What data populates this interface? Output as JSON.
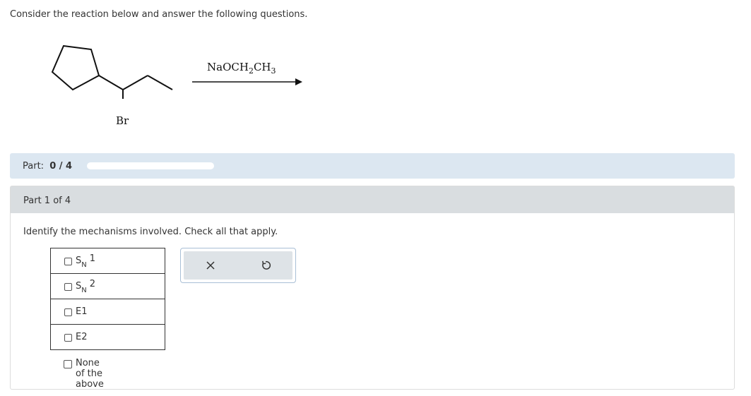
{
  "intro": "Consider the reaction below and answer the following questions.",
  "reaction": {
    "reagent_main": "NaOCH",
    "reagent_sub1": "2",
    "reagent_mid": "CH",
    "reagent_sub2": "3",
    "substituent": "Br"
  },
  "part_bar": {
    "label": "Part:",
    "progress_text": "0 / 4",
    "progress_fraction": 0
  },
  "card": {
    "header": "Part 1 of 4",
    "question": "Identify the mechanisms involved. Check all that apply."
  },
  "options": [
    {
      "s": "S",
      "sub": "N",
      "num": "1"
    },
    {
      "s": "S",
      "sub": "N",
      "num": "2"
    },
    {
      "label": "E1"
    },
    {
      "label": "E2"
    }
  ],
  "none_option": "None of the above",
  "tools": {
    "clear_icon": "close-icon",
    "undo_icon": "undo-icon",
    "clear_glyph": "✕"
  }
}
